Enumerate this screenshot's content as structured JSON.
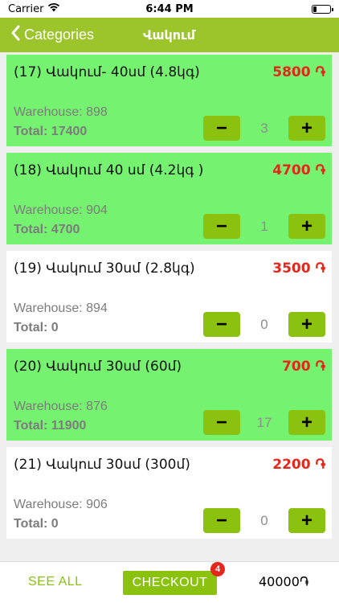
{
  "status_bar": {
    "carrier": "Carrier",
    "time": "6:44 PM",
    "battery_level": 0.2
  },
  "nav": {
    "back_label": "Categories",
    "title": "Վակում",
    "accent_color": "#9bc52b"
  },
  "products": [
    {
      "name": "(17) Վակում- 40սմ (4.8կգ)",
      "price": "5800 ֏",
      "warehouse": "Warehouse: 898",
      "total": "Total: 17400",
      "quantity": "3",
      "selected": true
    },
    {
      "name": "(18) Վակում 40 սմ (4.2կգ )",
      "price": "4700 ֏",
      "warehouse": "Warehouse: 904",
      "total": "Total: 4700",
      "quantity": "1",
      "selected": true
    },
    {
      "name": "(19) Վակում 30սմ (2.8կգ)",
      "price": "3500 ֏",
      "warehouse": "Warehouse: 894",
      "total": "Total: 0",
      "quantity": "0",
      "selected": false
    },
    {
      "name": "(20) Վակում 30սմ (60մ)",
      "price": "700 ֏",
      "warehouse": "Warehouse: 876",
      "total": "Total: 11900",
      "quantity": "17",
      "selected": true
    },
    {
      "name": "(21) Վակում 30սմ (300մ)",
      "price": "2200 ֏",
      "warehouse": "Warehouse: 906",
      "total": "Total: 0",
      "quantity": "0",
      "selected": false
    }
  ],
  "controls": {
    "minus_symbol": "−",
    "plus_symbol": "+"
  },
  "bottom_bar": {
    "see_all_label": "SEE ALL",
    "checkout_label": "CHECKOUT",
    "badge_count": "4",
    "cart_total": "40000֏"
  },
  "colors": {
    "selected_card": "#75f26f",
    "price": "#e5261b",
    "button": "#8ac20f"
  },
  "icons": {
    "back": "chevron-left-icon",
    "wifi": "wifi-icon",
    "battery": "battery-icon"
  }
}
